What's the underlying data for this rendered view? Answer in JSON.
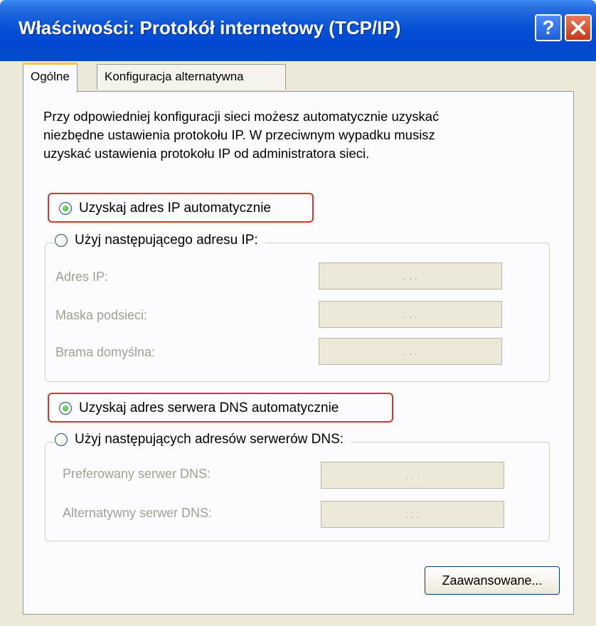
{
  "window": {
    "title": "Właściwości: Protokół internetowy (TCP/IP)",
    "help_glyph": "?",
    "close_icon": "close-icon"
  },
  "tabs": [
    {
      "label": "Ogólne",
      "selected": true
    },
    {
      "label": "Konfiguracja alternatywna",
      "selected": false
    }
  ],
  "intro": {
    "line1": "Przy odpowiedniej konfiguracji sieci możesz automatycznie uzyskać",
    "line2": "niezbędne ustawienia protokołu IP. W przeciwnym wypadku musisz",
    "line3": "uzyskać ustawienia protokołu IP od administratora sieci."
  },
  "ip": {
    "auto": {
      "label": "Uzyskaj adres IP automatycznie",
      "selected": true
    },
    "manual": {
      "label": "Użyj następującego adresu IP:",
      "selected": false
    },
    "fields": [
      {
        "label": "Adres IP:",
        "value": ". . ."
      },
      {
        "label": "Maska podsieci:",
        "value": ". . ."
      },
      {
        "label": "Brama domyślna:",
        "value": ". . ."
      }
    ]
  },
  "dns": {
    "auto": {
      "label": "Uzyskaj adres serwera DNS automatycznie",
      "selected": true
    },
    "manual": {
      "label": "Użyj następujących adresów serwerów DNS:",
      "selected": false
    },
    "fields": [
      {
        "label": "Preferowany serwer DNS:",
        "value": ". . ."
      },
      {
        "label": "Alternatywny serwer DNS:",
        "value": ". . ."
      }
    ]
  },
  "buttons": {
    "advanced": "Zaawansowane..."
  },
  "colors": {
    "highlight": "#d9342b",
    "titlebar": "#0a55d8",
    "dialog_bg": "#ece9d8"
  }
}
